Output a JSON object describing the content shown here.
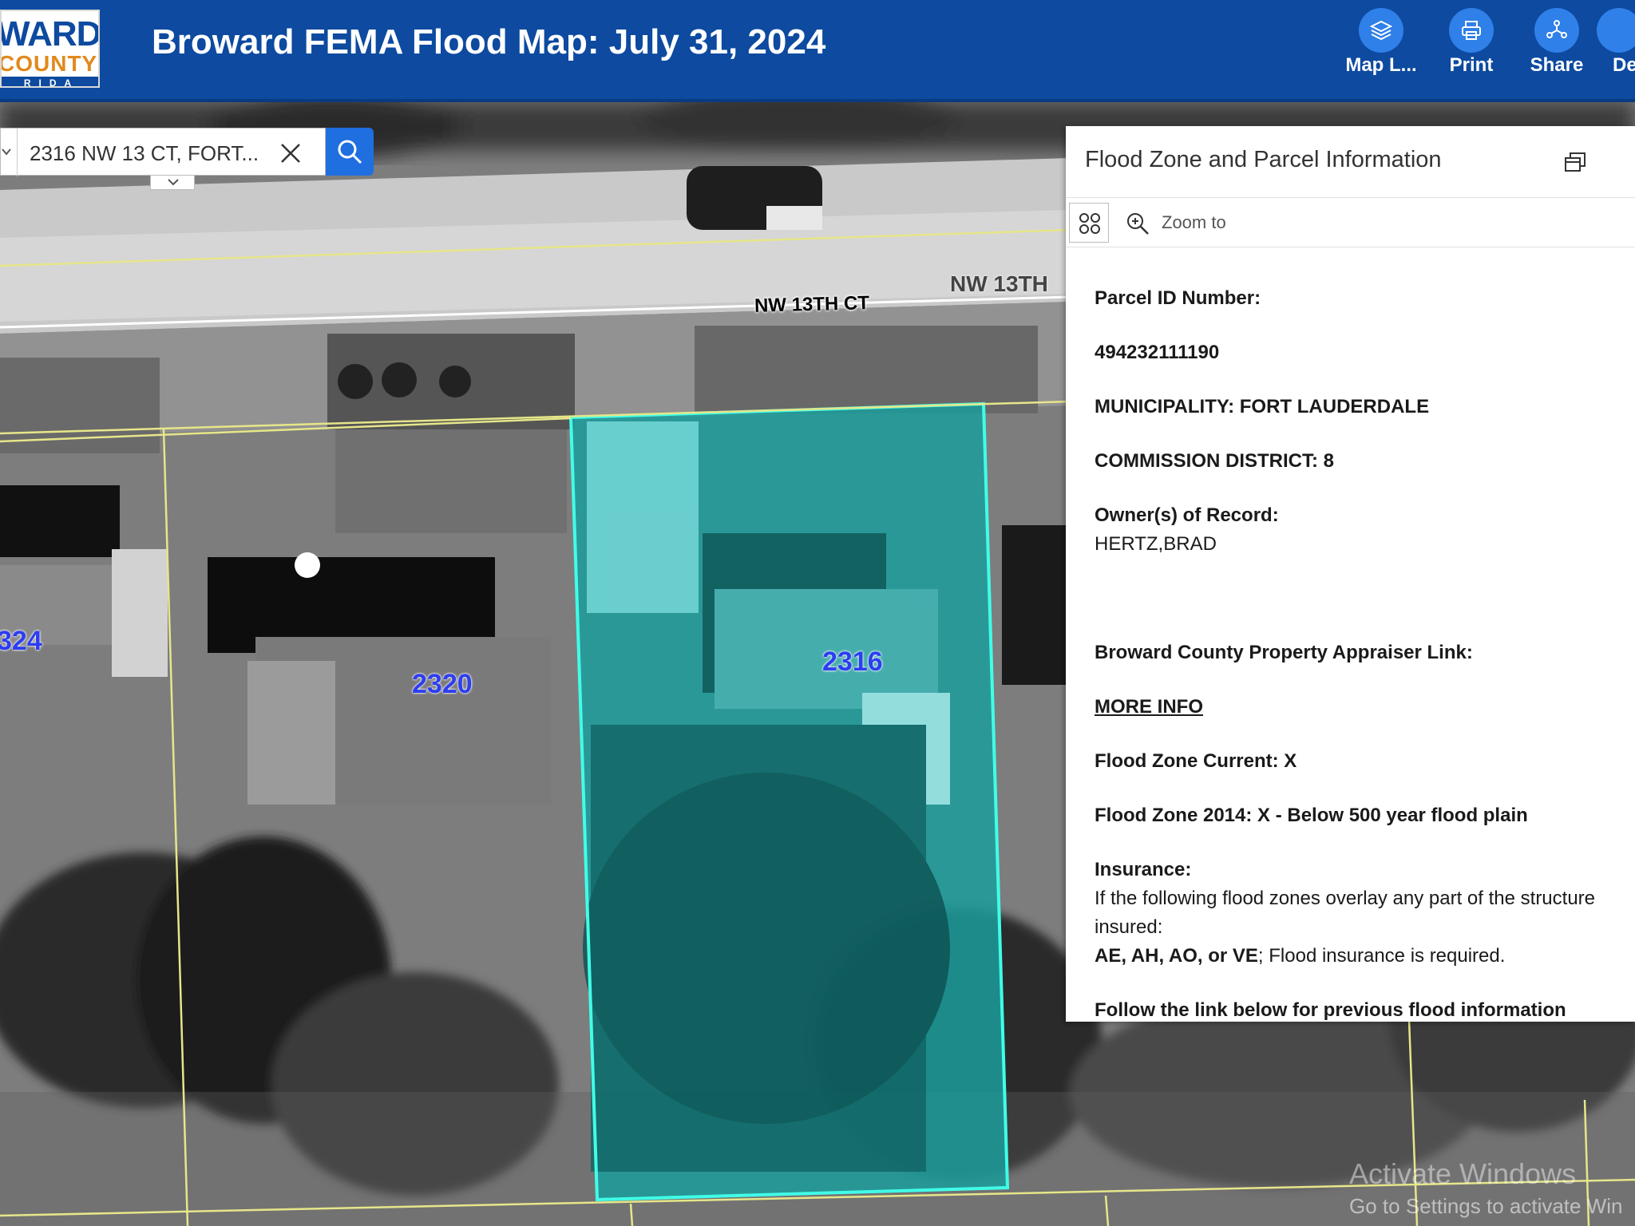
{
  "header": {
    "logo": {
      "line1": "WARD",
      "line2": "COUNTY",
      "line3": "RIDA"
    },
    "title": "Broward FEMA Flood Map:  July 31, 2024",
    "tools": [
      {
        "label": "Map L...",
        "icon": "layers-icon"
      },
      {
        "label": "Print",
        "icon": "printer-icon"
      },
      {
        "label": "Share",
        "icon": "share-icon"
      },
      {
        "label": "De",
        "icon": "details-icon"
      }
    ]
  },
  "search": {
    "value": "2316 NW 13 CT, FORT..."
  },
  "map": {
    "streets": [
      "NW 13TH CT",
      "NW 13TH"
    ],
    "parcels": [
      "324",
      "2320",
      "2316"
    ],
    "watermark": [
      "Activate Windows",
      "Go to Settings to activate Win"
    ]
  },
  "popup": {
    "title": "Flood Zone and Parcel Information",
    "zoom_to": "Zoom to",
    "parcel_id_label": "Parcel ID Number:",
    "parcel_id": "494232111190",
    "municipality": "MUNICIPALITY: FORT LAUDERDALE",
    "commission": "COMMISSION DISTRICT: 8",
    "owner_label": "Owner(s) of Record:",
    "owner": "HERTZ,BRAD",
    "appraiser_label": "Broward County Property Appraiser Link:",
    "more_info": "MORE INFO",
    "flood_current": "Flood Zone Current: X",
    "flood_2014": "Flood Zone 2014: X - Below 500 year flood plain",
    "insurance_label": "Insurance:",
    "insurance_line1": "If the following flood zones overlay any part of the structure",
    "insurance_line2": "insured:",
    "insurance_zones": "AE, AH, AO, or VE",
    "insurance_required": "; Flood insurance is required.",
    "follow_link": "Follow the link below for  previous flood information"
  }
}
